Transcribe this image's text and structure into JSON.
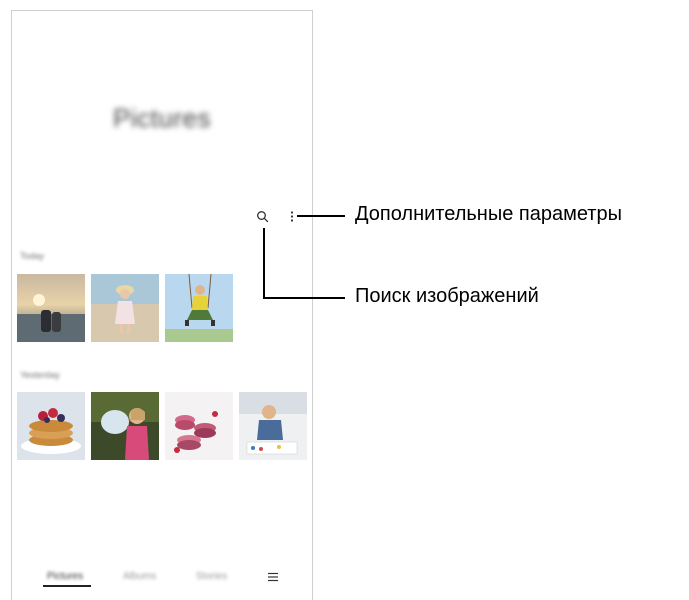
{
  "app": {
    "title": "Pictures"
  },
  "toolbar": {
    "search_icon": "search-icon",
    "more_icon": "more-options-icon"
  },
  "sections": [
    {
      "label": "Today",
      "thumbnails": [
        "sunset-couple-photo",
        "girl-on-beach-photo",
        "boy-on-swing-photo"
      ]
    },
    {
      "label": "Yesterday",
      "thumbnails": [
        "pancakes-photo",
        "girl-splashing-water-photo",
        "macarons-photo",
        "toddler-painting-photo"
      ]
    }
  ],
  "bottom_nav": {
    "tabs": [
      "Pictures",
      "Albums",
      "Stories"
    ],
    "active": "Pictures",
    "menu_icon": "hamburger-menu-icon"
  },
  "callouts": {
    "more_options": "Дополнительные параметры",
    "search_images": "Поиск изображений"
  }
}
